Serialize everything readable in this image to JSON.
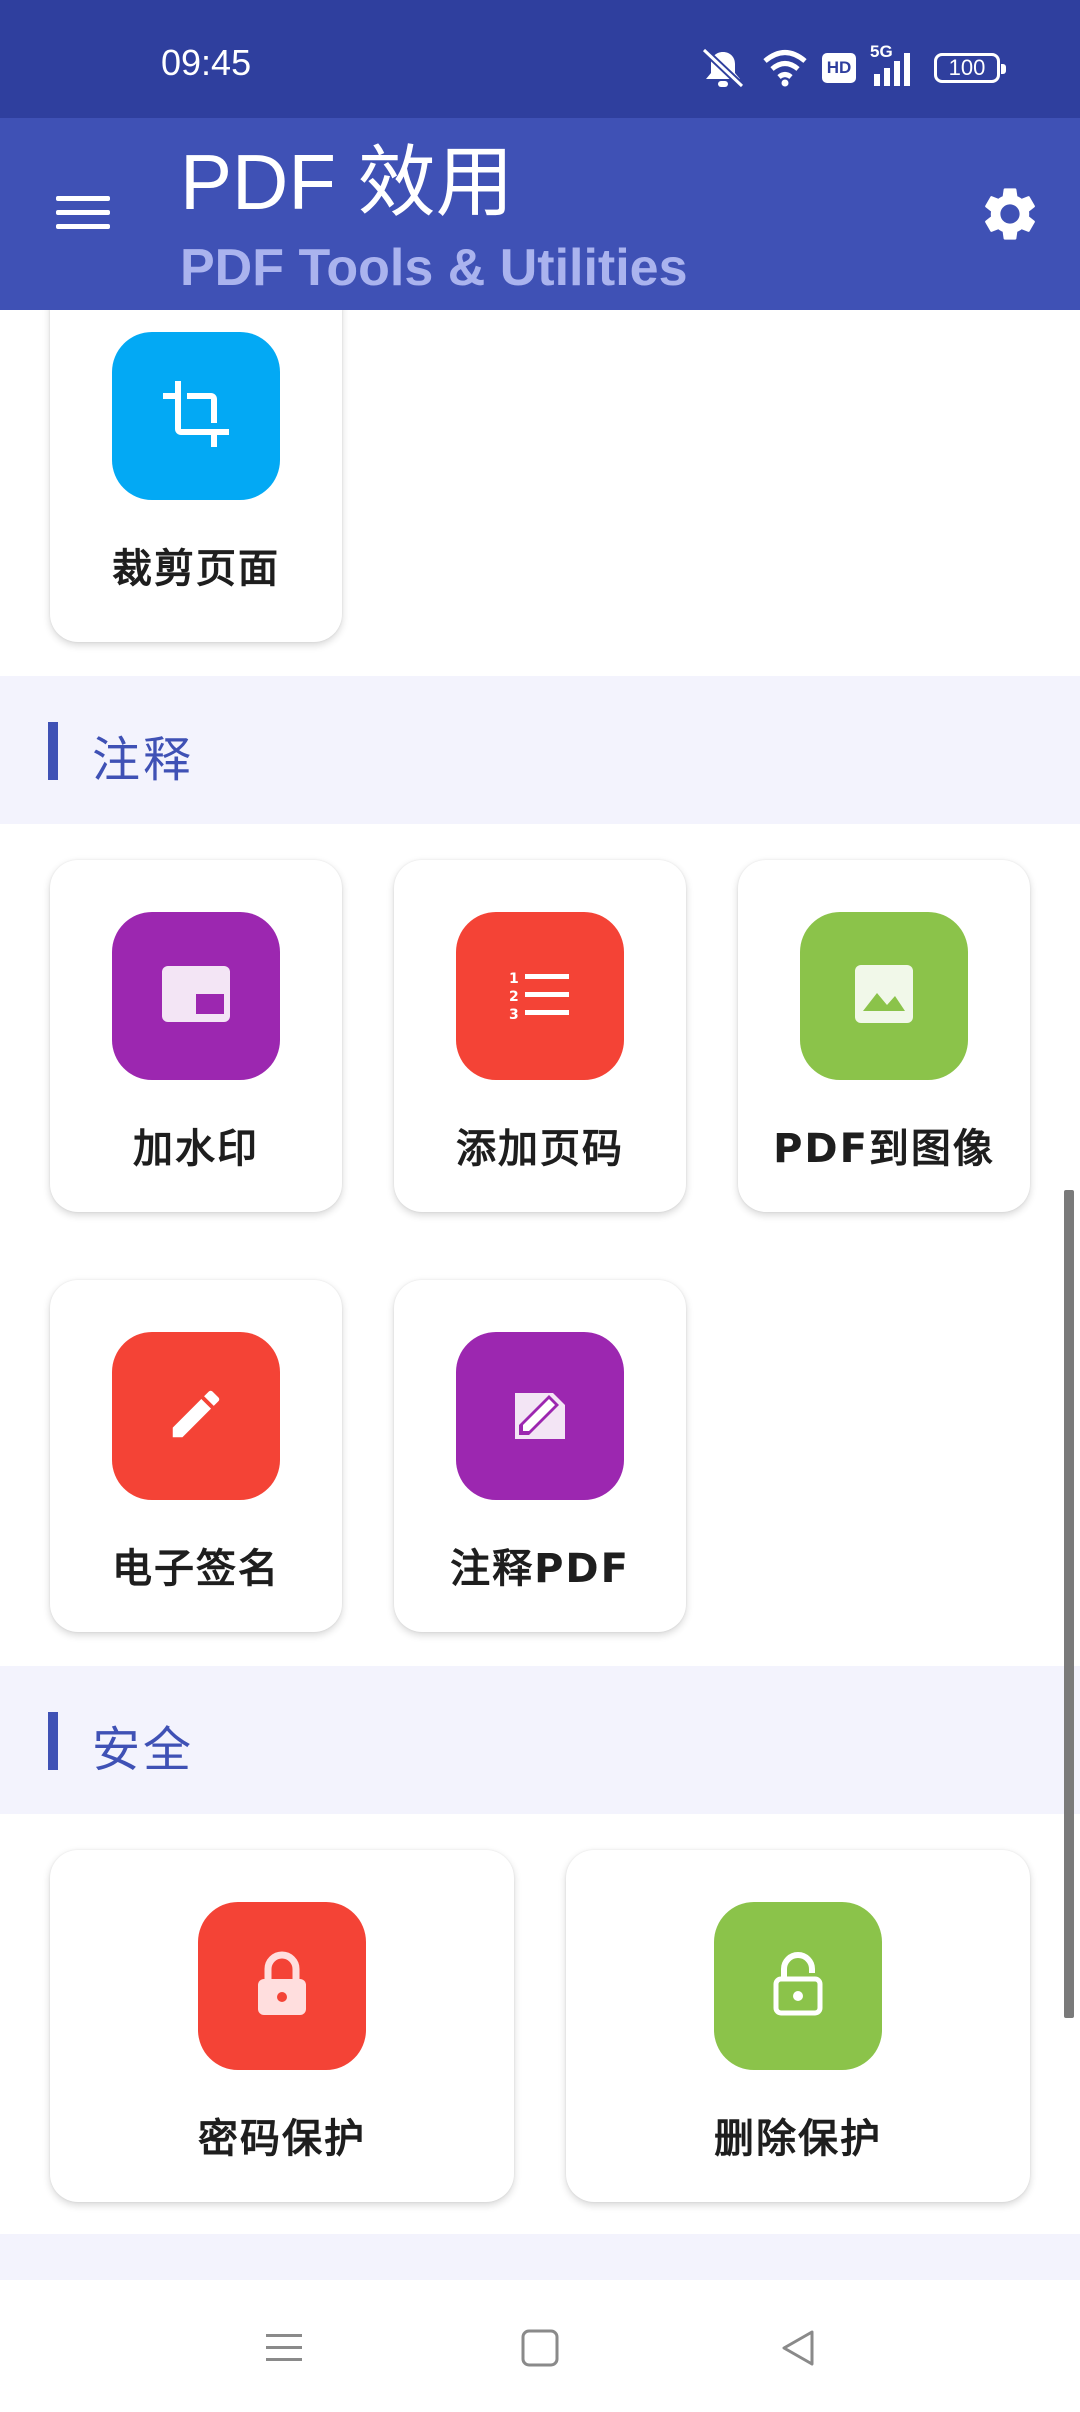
{
  "status_bar": {
    "time": "09:45",
    "network_label": "5G",
    "hd_label": "HD",
    "battery": "100"
  },
  "app_bar": {
    "title": "PDF 效用",
    "subtitle": "PDF Tools & Utilities"
  },
  "crop_card": {
    "label": "裁剪页面",
    "color": "#03a9f4",
    "icon": "crop-icon"
  },
  "sections": {
    "annotation": {
      "title": "注释",
      "items": [
        {
          "label": "加水印",
          "color": "#9c27b0",
          "icon": "watermark-icon"
        },
        {
          "label": "添加页码",
          "color": "#f44336",
          "icon": "numbered-list-icon"
        },
        {
          "label": "PDF到图像",
          "color": "#8bc34a",
          "icon": "image-icon"
        },
        {
          "label": "电子签名",
          "color": "#f44336",
          "icon": "pencil-icon"
        },
        {
          "label": "注释PDF",
          "color": "#9c27b0",
          "icon": "annotate-icon"
        }
      ]
    },
    "security": {
      "title": "安全",
      "items": [
        {
          "label": "密码保护",
          "color": "#f44336",
          "icon": "lock-icon"
        },
        {
          "label": "删除保护",
          "color": "#8bc34a",
          "icon": "unlock-icon"
        }
      ]
    }
  }
}
